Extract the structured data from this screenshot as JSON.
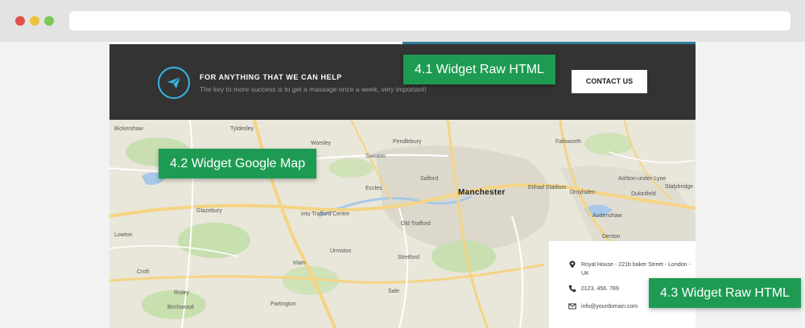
{
  "browser": {
    "url": ""
  },
  "cta": {
    "title": "FOR ANYTHING THAT WE CAN HELP",
    "subtitle": "The key to more success is to get a massage once a week, very important!",
    "button_label": "CONTACT US",
    "icon": "paper-plane-icon",
    "accent_color": "#35b6e5",
    "background_color": "#333333"
  },
  "map": {
    "city_label": "Manchester",
    "places": [
      "Bickershaw",
      "Tyldesley",
      "Worsley",
      "Swinton",
      "Pendlebury",
      "Failsworth",
      "Salford",
      "Eccles",
      "Etihad Stadium",
      "Ashton-under-Lyne",
      "Droylsden",
      "Dukinfield",
      "Stalybridge",
      "Glazebury",
      "intu Trafford Centre",
      "Old Trafford",
      "Urmston",
      "Stretford",
      "Audenshaw",
      "Croft",
      "Risley",
      "Birchwood",
      "Partington",
      "Sale",
      "Irlam",
      "Denton",
      "Lowton"
    ]
  },
  "contact": {
    "address": "Royal House - 221b baker Street - London - UK",
    "phone": "0123. 456. 789",
    "email": "info@yourdomain.com"
  },
  "annotations": {
    "badge_1": "4.1 Widget Raw HTML",
    "badge_2": "4.2 Widget Google Map",
    "badge_3": "4.3 Widget Raw HTML",
    "badge_color": "#1e9b52"
  }
}
